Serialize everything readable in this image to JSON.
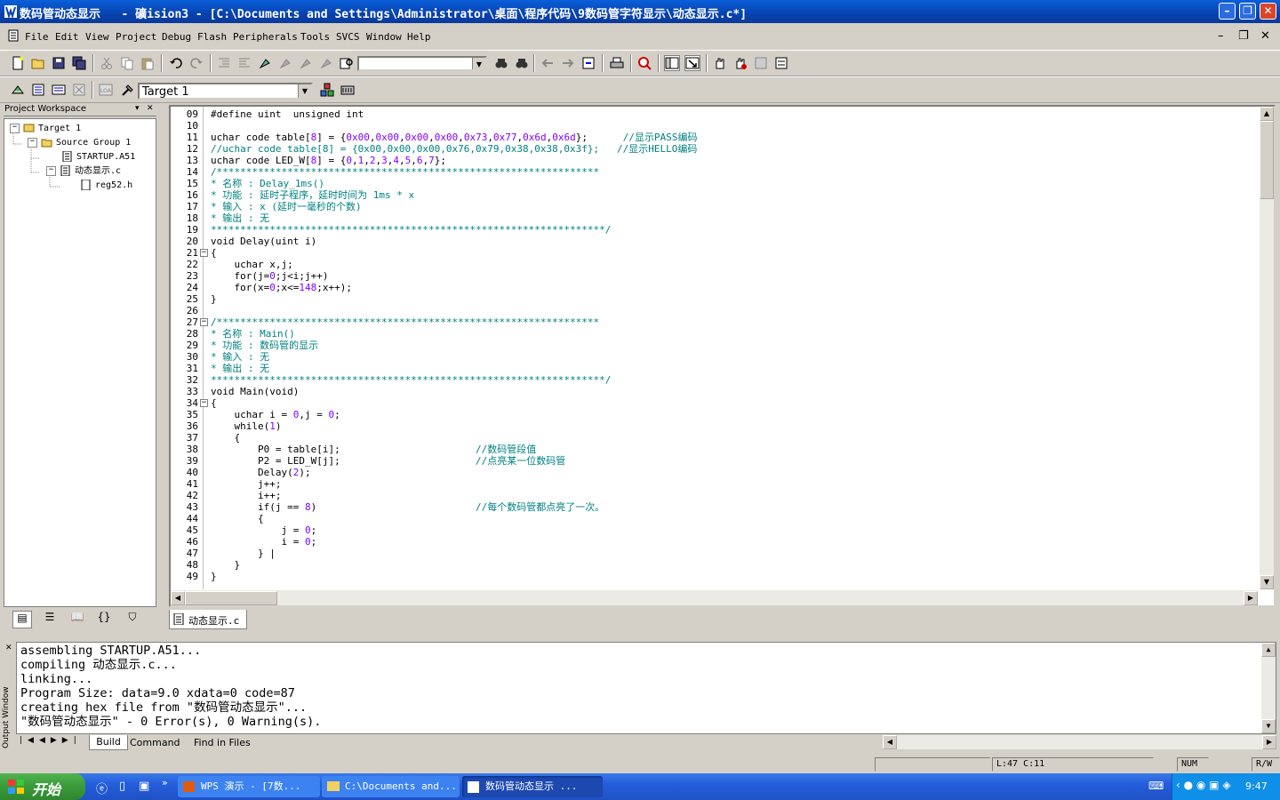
{
  "window": {
    "title": "数码管动态显示   - 礦ision3 - [C:\\Documents and Settings\\Administrator\\桌面\\程序代码\\9数码管字符显示\\动态显示.c*]",
    "minimize": "–",
    "restore": "❐",
    "close": "✕"
  },
  "menu": {
    "items": [
      "File",
      "Edit",
      "View",
      "Project",
      "Debug",
      "Flash",
      "Peripherals",
      "Tools",
      "SVCS",
      "Window",
      "Help"
    ],
    "mdi_minimize": "–",
    "mdi_restore": "❐",
    "mdi_close": "✕"
  },
  "toolbar2": {
    "target": "Target 1"
  },
  "workspace": {
    "header": "Project Workspace",
    "pin": "▾",
    "close": "✕",
    "tree": [
      {
        "label": "Target  1",
        "indent": 0,
        "toggle": "−"
      },
      {
        "label": "Source Group 1",
        "indent": 1,
        "toggle": "−"
      },
      {
        "label": "STARTUP.A51",
        "indent": 2,
        "toggle": ""
      },
      {
        "label": "动态显示.c",
        "indent": 2,
        "toggle": "−"
      },
      {
        "label": "reg52.h",
        "indent": 3,
        "toggle": ""
      }
    ]
  },
  "editor": {
    "tab": "动态显示.c",
    "lines": [
      {
        "n": "09",
        "t": "#define uint  unsigned int",
        "c": ""
      },
      {
        "n": "10",
        "t": "",
        "c": ""
      },
      {
        "n": "11",
        "t": "uchar code table[8] = {0x00,0x00,0x00,0x00,0x73,0x77,0x6d,0x6d};      //显示PASS编码",
        "c": "mix"
      },
      {
        "n": "12",
        "t": "//uchar code table[8] = {0x00,0x00,0x00,0x76,0x79,0x38,0x38,0x3f};   //显示HELLO编码",
        "c": "cmt"
      },
      {
        "n": "13",
        "t": "uchar code LED_W[8] = {0,1,2,3,4,5,6,7};",
        "c": "mix"
      },
      {
        "n": "14",
        "t": "/*****************************************************************",
        "c": "cmt"
      },
      {
        "n": "15",
        "t": "* 名称 : Delay_1ms()",
        "c": "cmt"
      },
      {
        "n": "16",
        "t": "* 功能 : 延时子程序，延时时间为 1ms * x",
        "c": "cmt"
      },
      {
        "n": "17",
        "t": "* 输入 : x (延时一毫秒的个数)",
        "c": "cmt"
      },
      {
        "n": "18",
        "t": "* 输出 : 无",
        "c": "cmt"
      },
      {
        "n": "19",
        "t": "*******************************************************************/",
        "c": "cmt"
      },
      {
        "n": "20",
        "t": "void Delay(uint i)",
        "c": ""
      },
      {
        "n": "21",
        "t": "{",
        "c": "",
        "fold": true
      },
      {
        "n": "22",
        "t": "    uchar x,j;",
        "c": ""
      },
      {
        "n": "23",
        "t": "    for(j=0;j<i;j++)",
        "c": "mix"
      },
      {
        "n": "24",
        "t": "    for(x=0;x<=148;x++);",
        "c": "mix"
      },
      {
        "n": "25",
        "t": "}",
        "c": ""
      },
      {
        "n": "26",
        "t": "",
        "c": ""
      },
      {
        "n": "27",
        "t": "/*****************************************************************",
        "c": "cmt",
        "fold": true
      },
      {
        "n": "28",
        "t": "* 名称 : Main()",
        "c": "cmt"
      },
      {
        "n": "29",
        "t": "* 功能 : 数码管的显示",
        "c": "cmt"
      },
      {
        "n": "30",
        "t": "* 输入 : 无",
        "c": "cmt"
      },
      {
        "n": "31",
        "t": "* 输出 : 无",
        "c": "cmt"
      },
      {
        "n": "32",
        "t": "*******************************************************************/",
        "c": "cmt"
      },
      {
        "n": "33",
        "t": "void Main(void)",
        "c": ""
      },
      {
        "n": "34",
        "t": "{",
        "c": "",
        "fold": true
      },
      {
        "n": "35",
        "t": "    uchar i = 0,j = 0;",
        "c": "mix"
      },
      {
        "n": "36",
        "t": "    while(1)",
        "c": "mix"
      },
      {
        "n": "37",
        "t": "    {",
        "c": ""
      },
      {
        "n": "38",
        "t": "        P0 = table[i];                       //数码管段值",
        "c": "mix"
      },
      {
        "n": "39",
        "t": "        P2 = LED_W[j];                       //点亮某一位数码管",
        "c": "mix"
      },
      {
        "n": "40",
        "t": "        Delay(2);",
        "c": "mix"
      },
      {
        "n": "41",
        "t": "        j++;",
        "c": ""
      },
      {
        "n": "42",
        "t": "        i++;",
        "c": ""
      },
      {
        "n": "43",
        "t": "        if(j == 8)                           //每个数码管都点亮了一次。",
        "c": "mix"
      },
      {
        "n": "44",
        "t": "        {",
        "c": ""
      },
      {
        "n": "45",
        "t": "            j = 0;",
        "c": "mix"
      },
      {
        "n": "46",
        "t": "            i = 0;",
        "c": "mix"
      },
      {
        "n": "47",
        "t": "        } |",
        "c": ""
      },
      {
        "n": "48",
        "t": "    }",
        "c": ""
      },
      {
        "n": "49",
        "t": "}",
        "c": ""
      }
    ]
  },
  "output": {
    "side_title": "Output Window",
    "close": "✕",
    "lines": [
      "assembling STARTUP.A51...",
      "compiling 动态显示.c...",
      "linking...",
      "Program Size: data=9.0 xdata=0 code=87",
      "creating hex file from \"数码管动态显示\"...",
      "\"数码管动态显示\" - 0 Error(s), 0 Warning(s)."
    ],
    "tabs": [
      "Build",
      "Command",
      "Find in Files"
    ]
  },
  "status": {
    "position": "L:47 C:11",
    "num": "NUM",
    "rw": "R/W"
  },
  "taskbar": {
    "start": "开始",
    "tasks": [
      "WPS 演示 - [7数...",
      "C:\\Documents and...",
      "数码管动态显示   ..."
    ],
    "time": "9:47"
  },
  "colors": {
    "comment": "#008080",
    "number": "#8000ff",
    "titlebar": "#0842b0"
  }
}
